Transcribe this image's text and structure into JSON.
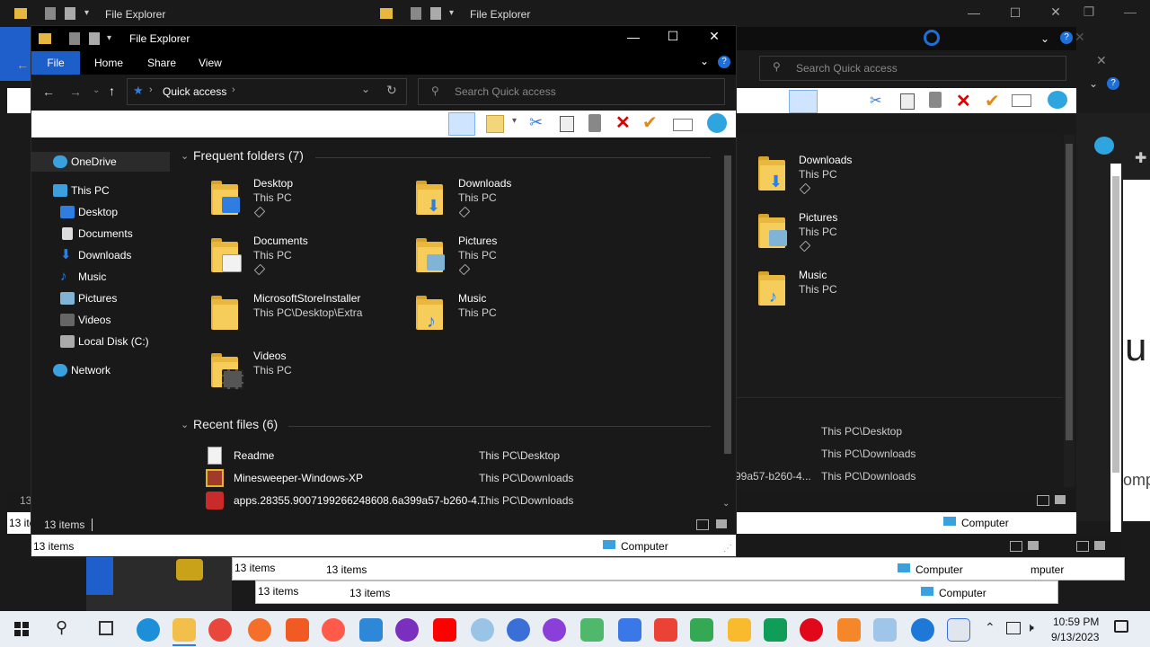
{
  "back_window_top": {
    "title": "File Explorer",
    "title2": "File Explorer",
    "search_placeholder": "Search Quick access"
  },
  "background_items": [
    {
      "name": "Downloads",
      "sub": "This PC"
    },
    {
      "name": "Pictures",
      "sub": "This PC"
    },
    {
      "name": "Music",
      "sub": "This PC"
    }
  ],
  "background_recent": [
    {
      "name": "...99a57-b260-4...",
      "loc": "This PC\\Desktop"
    },
    {
      "name": "",
      "loc": "This PC\\Downloads"
    },
    {
      "name": "99a57-b260-4...",
      "loc": "This PC\\Downloads"
    }
  ],
  "background_status": {
    "items_a": "13 items",
    "items_b": "13 items",
    "items_c": "13 items",
    "items_d": "13 items",
    "items_e": "13 items",
    "computer_a": "Computer",
    "computer_b": "Computer",
    "computer_c": "Computer",
    "computer_d": "mputer",
    "side_text": "omp",
    "big_letter": "u"
  },
  "window": {
    "title": "File Explorer",
    "tabs": [
      "File",
      "Home",
      "Share",
      "View"
    ],
    "address": "Quick access",
    "search_placeholder": "Search Quick access",
    "status_items": "13 items",
    "status_items_bottom": "13 items",
    "status_computer": "Computer"
  },
  "nav": {
    "onedrive": "OneDrive",
    "thispc": "This PC",
    "desktop": "Desktop",
    "documents": "Documents",
    "downloads": "Downloads",
    "music": "Music",
    "pictures": "Pictures",
    "videos": "Videos",
    "localdisk": "Local Disk (C:)",
    "network": "Network"
  },
  "frequent": {
    "header": "Frequent folders (7)",
    "items": [
      {
        "name": "Desktop",
        "sub": "This PC",
        "pinned": true
      },
      {
        "name": "Downloads",
        "sub": "This PC",
        "pinned": true
      },
      {
        "name": "Documents",
        "sub": "This PC",
        "pinned": true
      },
      {
        "name": "Pictures",
        "sub": "This PC",
        "pinned": true
      },
      {
        "name": "MicrosoftStoreInstaller",
        "sub": "This PC\\Desktop\\Extra",
        "pinned": false
      },
      {
        "name": "Music",
        "sub": "This PC",
        "pinned": false
      },
      {
        "name": "Videos",
        "sub": "This PC",
        "pinned": false
      }
    ]
  },
  "recent": {
    "header": "Recent files (6)",
    "items": [
      {
        "name": "Readme",
        "loc": "This PC\\Desktop"
      },
      {
        "name": "Minesweeper-Windows-XP",
        "loc": "This PC\\Downloads"
      },
      {
        "name": "apps.28355.9007199266248608.6a399a57-b260-4...",
        "loc": "This PC\\Downloads"
      }
    ]
  },
  "taskbar": {
    "time": "10:59 PM",
    "date": "9/13/2023"
  },
  "colors": {
    "accent": "#0a64d8",
    "folder": "#f6cd5a",
    "window_bg": "#191919",
    "selection": "#2b2b2b"
  }
}
